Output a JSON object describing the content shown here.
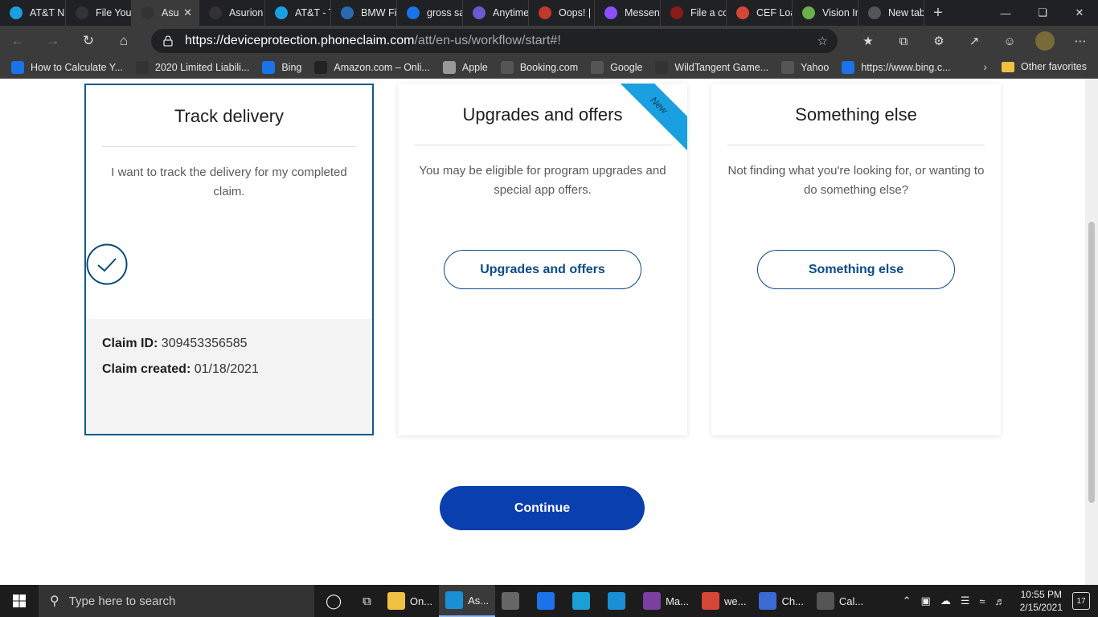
{
  "browser": {
    "tabs": [
      {
        "title": "AT&T N",
        "color": "#1aa0e0",
        "icon": "att-icon"
      },
      {
        "title": "File Your",
        "color": "#333333",
        "icon": "asurion-icon"
      },
      {
        "title": "Asu",
        "color": "#333333",
        "icon": "asurion-icon",
        "active": true
      },
      {
        "title": "Asurion",
        "color": "#333333",
        "icon": "asurion-icon"
      },
      {
        "title": "AT&T - T",
        "color": "#1aa0e0",
        "icon": "att-icon"
      },
      {
        "title": "BMW Fir",
        "color": "#2a6ab0",
        "icon": "bmw-icon"
      },
      {
        "title": "gross sa",
        "color": "#1a73e8",
        "icon": "bing-icon"
      },
      {
        "title": "Anytime",
        "color": "#6a5acd",
        "icon": "anytime-icon"
      },
      {
        "title": "Oops! | I",
        "color": "#c0392b",
        "icon": "oops-icon"
      },
      {
        "title": "Messeng",
        "color": "#8a4fff",
        "icon": "messenger-icon"
      },
      {
        "title": "File a co",
        "color": "#8b1a1a",
        "icon": "shield-icon"
      },
      {
        "title": "CEF Loa",
        "color": "#d44638",
        "icon": "gmail-icon"
      },
      {
        "title": "Vision In",
        "color": "#6ab04c",
        "icon": "vision-icon"
      },
      {
        "title": "New tab",
        "color": "#555555",
        "icon": "newtab-icon"
      }
    ],
    "url_host": "https://deviceprotection.phoneclaim.com",
    "url_path": "/att/en-us/workflow/start#!",
    "favorites": [
      {
        "label": "How to Calculate Y...",
        "color": "#1a73e8"
      },
      {
        "label": "2020 Limited Liabili...",
        "color": "#333333"
      },
      {
        "label": "Bing",
        "color": "#1a73e8"
      },
      {
        "label": "Amazon.com – Onli...",
        "color": "#222222"
      },
      {
        "label": "Apple",
        "color": "#999999"
      },
      {
        "label": "Booking.com",
        "color": "#555555"
      },
      {
        "label": "Google",
        "color": "#555555"
      },
      {
        "label": "WildTangent Game...",
        "color": "#333333"
      },
      {
        "label": "Yahoo",
        "color": "#555555"
      },
      {
        "label": "https://www.bing.c...",
        "color": "#1a73e8"
      }
    ],
    "other_favorites": "Other favorites"
  },
  "cards": {
    "track": {
      "title": "Track delivery",
      "description": "I want to track the delivery for my completed claim.",
      "claim_id_label": "Claim ID:",
      "claim_id_value": "309453356585",
      "claim_created_label": "Claim created:",
      "claim_created_value": "01/18/2021"
    },
    "upgrades": {
      "title": "Upgrades and offers",
      "ribbon": "New",
      "description": "You may be eligible for program upgrades and special app offers.",
      "button": "Upgrades and offers"
    },
    "else": {
      "title": "Something else",
      "description": "Not finding what you're looking for, or wanting to do something else?",
      "button": "Something else"
    }
  },
  "continue_button": "Continue",
  "taskbar": {
    "search_placeholder": "Type here to search",
    "apps": [
      {
        "label": "On...",
        "color": "#f0c040",
        "icon": "onedrive-icon"
      },
      {
        "label": "As...",
        "color": "#1a8fd6",
        "icon": "edge-icon",
        "active": true
      },
      {
        "label": "",
        "color": "#666666",
        "icon": "store-icon"
      },
      {
        "label": "",
        "color": "#1a73e8",
        "icon": "mail-icon"
      },
      {
        "label": "",
        "color": "#1a9fd6",
        "icon": "app-icon"
      },
      {
        "label": "",
        "color": "#1a8fd6",
        "icon": "app2-icon"
      },
      {
        "label": "Ma...",
        "color": "#7b3fa0",
        "icon": "onenote-icon"
      },
      {
        "label": "we...",
        "color": "#d44638",
        "icon": "pdf-icon"
      },
      {
        "label": "Ch...",
        "color": "#3a6ad4",
        "icon": "check-app-icon"
      },
      {
        "label": "Cal...",
        "color": "#555555",
        "icon": "calculator-icon"
      }
    ],
    "time": "10:55 PM",
    "date": "2/15/2021",
    "notifications": "17"
  }
}
